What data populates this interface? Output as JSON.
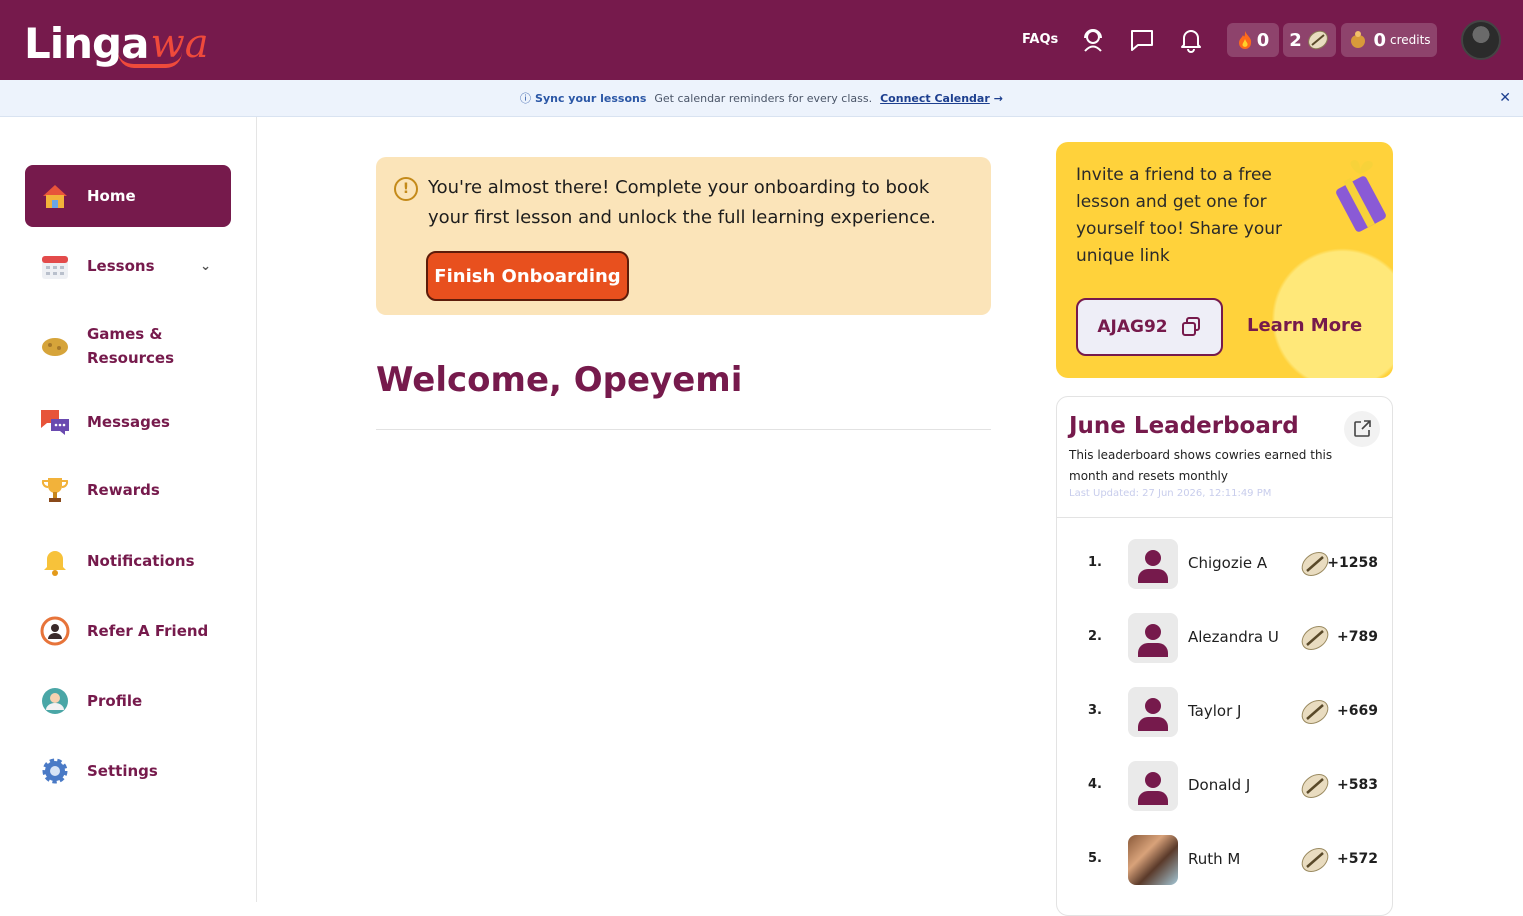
{
  "header": {
    "logo_main": "Linga",
    "logo_accent": "wa",
    "faqs_label": "FAQs",
    "streak_count": "0",
    "cowrie_count": "2",
    "credits_count": "0",
    "credits_label": "credits"
  },
  "sync_banner": {
    "title": "Sync your lessons",
    "text": "Get calendar reminders for every class.",
    "link": "Connect Calendar"
  },
  "sidebar": {
    "items": [
      {
        "label": "Home"
      },
      {
        "label": "Lessons"
      },
      {
        "label": "Games & Resources"
      },
      {
        "label": "Messages"
      },
      {
        "label": "Rewards"
      },
      {
        "label": "Notifications"
      },
      {
        "label": "Refer A Friend"
      },
      {
        "label": "Profile"
      },
      {
        "label": "Settings"
      }
    ]
  },
  "onboarding": {
    "message": "You're almost there! Complete your onboarding to book your first lesson and unlock the full learning experience.",
    "button": "Finish Onboarding"
  },
  "main": {
    "welcome": "Welcome, Opeyemi"
  },
  "invite": {
    "text": "Invite a friend to a free lesson and get one for yourself too! Share your unique link",
    "code": "AJAG92",
    "learn_more": "Learn More"
  },
  "leaderboard": {
    "title": "June Leaderboard",
    "description": "This leaderboard shows cowries earned this month and resets monthly",
    "updated": "Last Updated: 27 Jun 2026, 12:11:49 PM",
    "rows": [
      {
        "rank": "1.",
        "name": "Chigozie A",
        "points": "+1258"
      },
      {
        "rank": "2.",
        "name": "Alezandra U",
        "points": "+789"
      },
      {
        "rank": "3.",
        "name": "Taylor J",
        "points": "+669"
      },
      {
        "rank": "4.",
        "name": "Donald J",
        "points": "+583"
      },
      {
        "rank": "5.",
        "name": "Ruth M",
        "points": "+572"
      }
    ]
  },
  "colors": {
    "brand": "#761a4c",
    "accent": "#e8501e",
    "banner_bg": "#fbe4b9",
    "invite_bg": "#ffd23b"
  },
  "icons": {
    "faq": "faq-icon",
    "support": "support-agent-icon",
    "chat": "chat-icon",
    "bell": "bell-icon",
    "flame": "flame-icon",
    "cowrie": "cowrie-shell-icon",
    "credits": "coin-bag-icon",
    "copy": "copy-icon",
    "external": "external-link-icon",
    "gift": "gift-icon"
  }
}
